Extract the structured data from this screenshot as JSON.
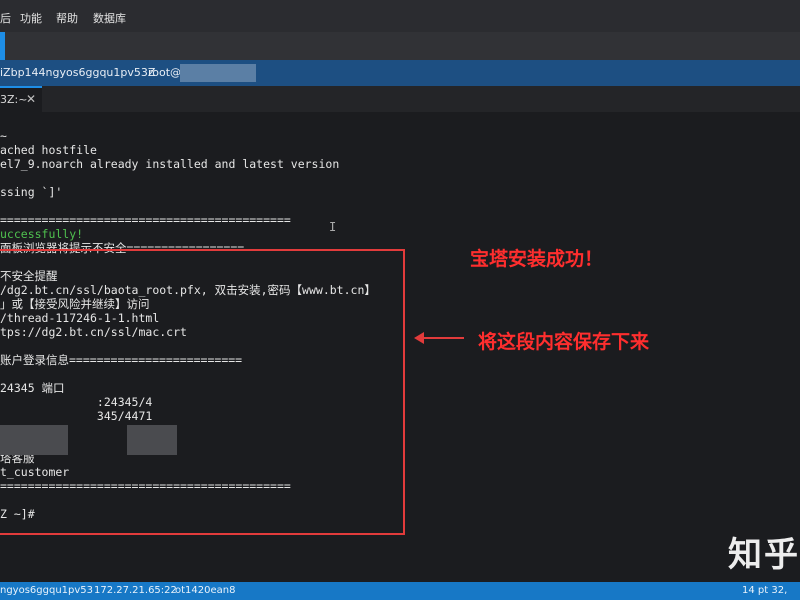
{
  "menu": {
    "items": [
      "后",
      "功能",
      "帮助",
      "数据库"
    ]
  },
  "session": {
    "id": "iZbp144ngyos6ggqu1pv53Z",
    "user": "root@"
  },
  "tab": {
    "title": "3Z:~",
    "close": "✕"
  },
  "terminal": {
    "lines": [
      "",
      "~",
      "ached hostfile",
      "el7_9.noarch already installed and latest version",
      "",
      "ssing `]'",
      "",
      "==========================================",
      "uccessfully!",
      "面板浏览器将提示不安全=================",
      "",
      "不安全提醒",
      "/dg2.bt.cn/ssl/baota_root.pfx, 双击安装,密码【www.bt.cn】",
      "」或【接受风险并继续】访问",
      "/thread-117246-1-1.html",
      "tps://dg2.bt.cn/ssl/mac.crt",
      "",
      "账户登录信息=========================",
      "",
      "24345 端口",
      "              :24345/4",
      "              345/4471",
      "",
      "",
      "塔客服",
      "t_customer",
      "==========================================",
      "",
      "Z ~]#"
    ],
    "green_line_index": 8,
    "cursor_char": "I"
  },
  "annotations": {
    "success": "宝塔安装成功！",
    "save": "将这段内容保存下来",
    "color": "#ff2e2e"
  },
  "watermark": {
    "text": "知乎"
  },
  "status": {
    "session": "ngyos6ggqu1pv53",
    "ip": "172.27.21.65:22",
    "host": "ot1420ean8",
    "right": "14 pt  32,"
  },
  "colors": {
    "accent": "#1e8ee6",
    "status_bar": "#1778c6",
    "session_bar": "#1d4f82"
  }
}
